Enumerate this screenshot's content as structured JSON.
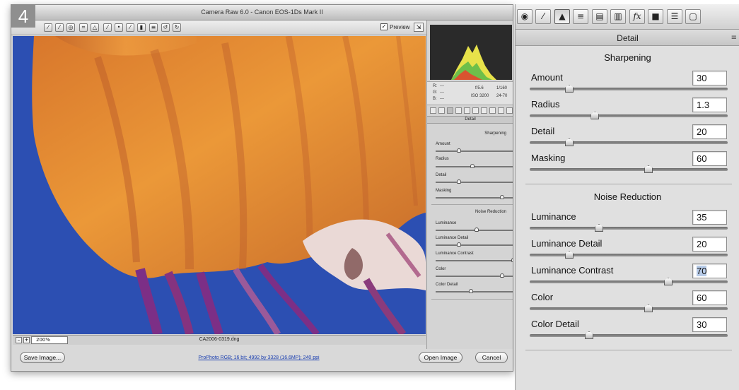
{
  "step_badge": "4",
  "window": {
    "title": "Camera Raw 6.0  -  Canon EOS-1Ds Mark II",
    "preview_label": "Preview",
    "zoom_value": "200%",
    "filename": "CA2006-0319.dng",
    "workflow_link": "ProPhoto RGB; 16 bit; 4992 by 3328 (16.6MP); 240 ppi",
    "save_button": "Save Image...",
    "open_button": "Open Image",
    "cancel_button": "Cancel"
  },
  "info_readout": {
    "r_label": "R:",
    "g_label": "G:",
    "b_label": "B:",
    "r_val": "---",
    "g_val": "---",
    "b_val": "---",
    "aperture": "f/5.6",
    "shutter": "1/160",
    "iso": "ISO 3200",
    "lens": "24-70"
  },
  "mini_panel": {
    "header": "Detail",
    "sharpening": "Sharpening",
    "noise_reduction": "Noise Reduction",
    "labels": [
      "Amount",
      "Radius",
      "Detail",
      "Masking",
      "Luminance",
      "Luminance Detail",
      "Luminance Contrast",
      "Color",
      "Color Detail"
    ]
  },
  "detail_panel": {
    "header": "Detail",
    "sharpening_title": "Sharpening",
    "noise_title": "Noise Reduction",
    "sliders": [
      {
        "label": "Amount",
        "value": "30",
        "fraction": 0.2
      },
      {
        "label": "Radius",
        "value": "1.3",
        "fraction": 0.33
      },
      {
        "label": "Detail",
        "value": "20",
        "fraction": 0.2
      },
      {
        "label": "Masking",
        "value": "60",
        "fraction": 0.6
      },
      {
        "label": "Luminance",
        "value": "35",
        "fraction": 0.35
      },
      {
        "label": "Luminance Detail",
        "value": "20",
        "fraction": 0.2
      },
      {
        "label": "Luminance Contrast",
        "value": "70",
        "fraction": 0.7
      },
      {
        "label": "Color",
        "value": "60",
        "fraction": 0.6
      },
      {
        "label": "Color Detail",
        "value": "30",
        "fraction": 0.3
      }
    ]
  },
  "colors": {
    "water_blue": "#2b4fb3",
    "jelly_orange": "#e5892f",
    "tentacle_purple": "#7c2f86",
    "selection_highlight": "#b7cbe8"
  }
}
